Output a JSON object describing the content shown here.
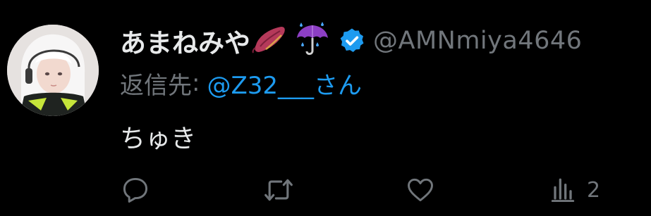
{
  "tweet": {
    "author": {
      "display_name": "あまねみや",
      "name_emojis": [
        "sweet-potato-emoji",
        "umbrella-with-rain-drops-emoji"
      ],
      "verified": true,
      "handle": "@AMNmiya4646"
    },
    "reply": {
      "label": "返信先",
      "separator": ":",
      "mention": "@Z32___さん"
    },
    "text": "ちゅき",
    "actions": {
      "reply": {
        "icon": "reply-icon"
      },
      "retweet": {
        "icon": "retweet-icon"
      },
      "like": {
        "icon": "heart-icon"
      },
      "views": {
        "icon": "views-chart-icon",
        "count": "2"
      }
    }
  },
  "colors": {
    "background": "#000000",
    "primary_text": "#e7e9ea",
    "secondary_text": "#71767b",
    "accent": "#1d9bf0"
  }
}
